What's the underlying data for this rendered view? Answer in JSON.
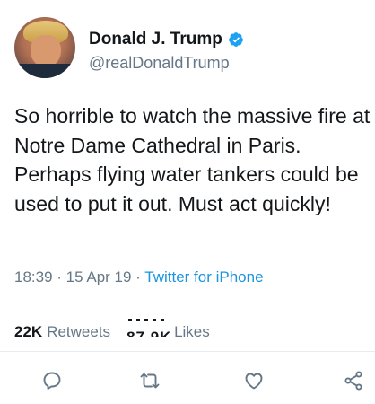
{
  "user": {
    "display_name": "Donald J. Trump",
    "handle": "@realDonaldTrump",
    "verified": true
  },
  "tweet": {
    "text": "So horrible to watch the massive fire at Notre Dame Cathedral in Paris. Perhaps flying water tankers could be used to put it out. Must act quickly!",
    "time": "18:39",
    "separator": " · ",
    "date": "15 Apr 19",
    "source": "Twitter for iPhone"
  },
  "stats": {
    "retweets_count": "22K",
    "retweets_label": "Retweets",
    "likes_count": "87.9K",
    "likes_label": "Likes"
  },
  "actions": [
    "reply-icon",
    "retweet-icon",
    "like-icon",
    "share-icon"
  ],
  "colors": {
    "text": "#14171a",
    "muted": "#657786",
    "link": "#1b95e0",
    "verified": "#1da1f2",
    "divider": "#e6ecf0"
  }
}
